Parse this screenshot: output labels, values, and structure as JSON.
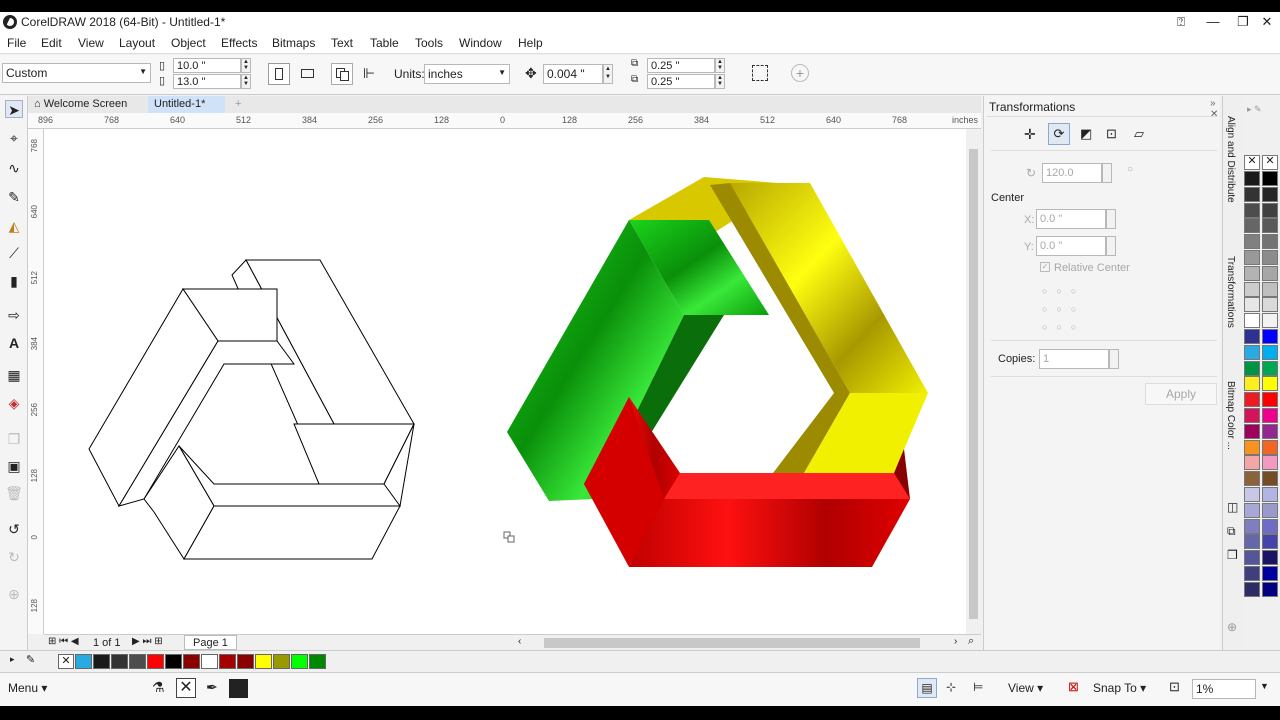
{
  "window": {
    "title": "CorelDRAW 2018 (64-Bit) - Untitled-1*",
    "minimize": "—",
    "restore": "❐",
    "close": "✕",
    "help_icon": "⍰"
  },
  "menu": [
    "File",
    "Edit",
    "View",
    "Layout",
    "Object",
    "Effects",
    "Bitmaps",
    "Text",
    "Table",
    "Tools",
    "Window",
    "Help"
  ],
  "propbar": {
    "page_preset": "Custom",
    "width": "10.0 \"",
    "height": "13.0 \"",
    "units_label": "Units:",
    "units": "inches",
    "nudge": "0.004 \"",
    "dup_x": "0.25 \"",
    "dup_y": "0.25 \""
  },
  "tabs": {
    "welcome": "Welcome Screen",
    "doc": "Untitled-1*",
    "add": "+"
  },
  "ruler": {
    "h_ticks": [
      "896",
      "768",
      "640",
      "512",
      "384",
      "256",
      "128",
      "0",
      "128",
      "256",
      "384",
      "512",
      "640",
      "768"
    ],
    "unit": "inches",
    "v_ticks": [
      "768",
      "640",
      "512",
      "384",
      "256",
      "128",
      "0",
      "128"
    ]
  },
  "pagebar": {
    "page_of": "1  of  1",
    "page_tab": "Page 1"
  },
  "docker": {
    "title": "Transformations",
    "rotation": "120.0",
    "center_label": "Center",
    "x_label": "X:",
    "x_value": "0.0 \"",
    "y_label": "Y:",
    "y_value": "0.0 \"",
    "relative_center": "Relative Center",
    "copies_label": "Copies:",
    "copies": "1",
    "apply": "Apply"
  },
  "side_tabs": [
    "Align and Distribute",
    "Transformations",
    "Bitmap Color ..."
  ],
  "palette": {
    "col1": [
      "#1a1a1a",
      "#333333",
      "#4d4d4d",
      "#666666",
      "#808080",
      "#999999",
      "#b3b3b3",
      "#cccccc",
      "#e6e6e6",
      "#ffffff",
      "#2e3192",
      "#29abe2",
      "#009245",
      "#fcee21",
      "#ed1c24",
      "#d4145a",
      "#9e005d",
      "#f7931e",
      "#f4a6a6",
      "#8c6239",
      "#c7c7e8",
      "#a8a8d8",
      "#7f7fbf",
      "#6666aa",
      "#555599",
      "#3f3f80",
      "#2b2b66"
    ],
    "col2": [
      "#000000",
      "#262626",
      "#404040",
      "#595959",
      "#737373",
      "#8c8c8c",
      "#a6a6a6",
      "#bfbfbf",
      "#d9d9d9",
      "#f2f2f2",
      "#0000ff",
      "#00aeef",
      "#00a651",
      "#ffff00",
      "#ff0000",
      "#ec008c",
      "#92278f",
      "#f26522",
      "#f49ac2",
      "#754c24",
      "#b3b3e6",
      "#9999cc",
      "#6d6dc8",
      "#4444aa",
      "#1b1464",
      "#0000a0",
      "#000080"
    ]
  },
  "doc_palette": [
    "#29abe2",
    "#1a1a1a",
    "#333333",
    "#4d4d4d",
    "#ff0000",
    "#000000",
    "#8b0000",
    "#ffffff",
    "#a50000",
    "#8b0000",
    "#ffff00",
    "#999900",
    "#00ff00",
    "#008800"
  ],
  "status": {
    "menu": "Menu",
    "view": "View",
    "snap": "Snap To",
    "zoom": "1%"
  }
}
